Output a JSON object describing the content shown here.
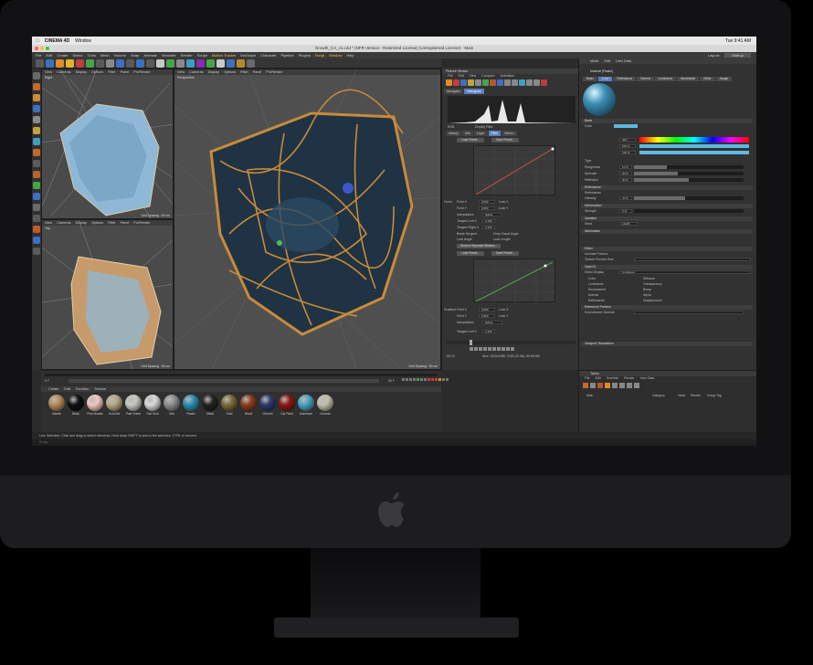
{
  "macos": {
    "app_name": "CINEMA 4D",
    "menu": [
      "Window"
    ],
    "clock": "Tue 9:41 AM"
  },
  "window": {
    "title": "Growth_CA_v1.c4d * (NFR Version - Restricted License) (Unregistered License) - Main"
  },
  "c4d_menu": {
    "items": [
      "File",
      "Edit",
      "Create",
      "Select",
      "Tools",
      "Mesh",
      "Volume",
      "Snap",
      "Animate",
      "Simulate",
      "Render",
      "Sculpt",
      "Motion Tracker",
      "MoGraph",
      "Character",
      "Pipeline",
      "Plugins",
      "Script",
      "Window",
      "Help"
    ],
    "layout_label": "Layout:",
    "layout_value": "Startup"
  },
  "viewports": {
    "top_left": {
      "menu": [
        "View",
        "Cameras",
        "Display",
        "Options",
        "Filter",
        "Panel",
        "ProRender"
      ],
      "label": "Right",
      "grid": "Grid Spacing : 50 cm"
    },
    "bottom_left": {
      "menu": [
        "View",
        "Cameras",
        "Display",
        "Options",
        "Filter",
        "Panel",
        "ProRender"
      ],
      "label": "Top",
      "grid": "Grid Spacing : 50 cm"
    },
    "main": {
      "menu": [
        "View",
        "Cameras",
        "Display",
        "Options",
        "Filter",
        "Panel",
        "ProRender"
      ],
      "label": "Perspective",
      "grid": "Grid Spacing : 50 cm"
    }
  },
  "timeline": {
    "start_frame": "0 F",
    "end_frame": "90 F"
  },
  "material_manager": {
    "menu": [
      "Create",
      "Edit",
      "Function",
      "Texture"
    ],
    "materials": [
      {
        "name": "Marble",
        "color": "#b58b5a"
      },
      {
        "name": "Black",
        "color": "#111111"
      },
      {
        "name": "Pink Shader",
        "color": "#f3c7c0"
      },
      {
        "name": "Gold Sat",
        "color": "#b8a986"
      },
      {
        "name": "Pale Green",
        "color": "#c6c9c1"
      },
      {
        "name": "Dull Gold",
        "color": "#d9d9d9"
      },
      {
        "name": "Mat",
        "color": "#8d8d8d"
      },
      {
        "name": "Plastic",
        "color": "#2b8fb3"
      },
      {
        "name": "Metal",
        "color": "#222222"
      },
      {
        "name": "Gold",
        "color": "#7a6b38"
      },
      {
        "name": "Wood",
        "color": "#8a3d1f"
      },
      {
        "name": "Chrome",
        "color": "#2d3d6b"
      },
      {
        "name": "Car Paint",
        "color": "#8c1a17"
      },
      {
        "name": "Aluminum",
        "color": "#4aa2bf"
      },
      {
        "name": "Ceramic",
        "color": "#c2bfae"
      }
    ]
  },
  "status": {
    "line1": "Live Selection: Click and drag to select elements. Hold down SHIFT to add to the selection, CTRL to remove.",
    "line2": "Ready"
  },
  "picture_viewer": {
    "title": "Picture Viewer",
    "menu": [
      "File",
      "Edit",
      "View",
      "Compare",
      "Animation"
    ],
    "tabs": [
      "Navigator",
      "Histogram"
    ],
    "active_tab": "Histogram",
    "display_filter": "Display Filter",
    "mode": "RGB",
    "filter_tabs": [
      "History",
      "Info",
      "Layer",
      "Filter",
      "Stereo"
    ],
    "active_filter_tab": "Filter",
    "load_preset": "Load Preset...",
    "save_preset": "Save Preset...",
    "curve_label": "Curve",
    "point_x": "Point X",
    "point_y": "Point Y",
    "lock_x": "Lock X",
    "lock_y": "Lock Y",
    "interpolation": "Interpolation",
    "interp_value": "Spline",
    "tangent_left": "Tangent Left X",
    "tangent_right": "Tangent Right X",
    "tangent_left_val": "0.166",
    "tangent_right_val": "0.166",
    "break_tangent": "Break Tangent",
    "keep_visual": "Keep Visual Angle",
    "lock_angle": "Lock Angle",
    "lock_length": "Lock Length",
    "show_separate": "Show in Separate Window...",
    "gradient_label": "Gradient",
    "point_x_val": "0.500",
    "point_y_val": "0.500",
    "zoom": "100 %",
    "size_info": "Size: 1920x1080, RGB (32 Bit), 89.58 MB"
  },
  "attributes": {
    "menu": [
      "Mode",
      "Edit",
      "User Data"
    ],
    "title": "Material [Plastic]",
    "tabs": [
      "Basic",
      "Color",
      "Reflectance",
      "Normal",
      "Luminance",
      "Illumination",
      "Editor",
      "Assign"
    ],
    "active_tab": "Color",
    "sections": {
      "basic": "Basic",
      "color": "Color",
      "reflectance": "Reflectance",
      "deformation": "Deformation",
      "variation": "Variation",
      "illumination": "Illumination",
      "editor": "Editor",
      "opengl": "OpenGL",
      "reference": "Reference Preview",
      "viewport": "Viewport Tessellation"
    },
    "rows": {
      "type": "Type",
      "roughness": "Roughness",
      "reflection": "Reflection",
      "specular": "Specular",
      "intensity": "Intensity",
      "strength": "Strength",
      "seed": "Seed",
      "animate": "Animate Preview",
      "texture_size": "Texture Preview Size",
      "display": "Editor Display",
      "display_val": "Combined",
      "color": "Color",
      "diffusion": "Diffusion",
      "luminance": "Luminance",
      "transparency": "Transparency",
      "environment": "Environment",
      "bump": "Bump",
      "normal": "Normal",
      "alpha": "Alpha",
      "reflectance": "Reflectance",
      "displacement": "Displacement",
      "env": "Environment Override"
    },
    "values": {
      "h": "200 °",
      "s": "100 %",
      "v": "100 %",
      "rough": "10 %",
      "spec": "20 %",
      "refl": "50 %",
      "intensity": "47 %",
      "strength": "0 %",
      "seed": "12345"
    },
    "swatch_color": "#5fb8e0"
  },
  "takes": {
    "menu": [
      "Takes"
    ],
    "submenu": [
      "File",
      "Edit",
      "Override",
      "Render",
      "User Data"
    ],
    "cols": [
      "Main",
      "Category",
      "Value",
      "Render",
      "Group Tag"
    ]
  }
}
